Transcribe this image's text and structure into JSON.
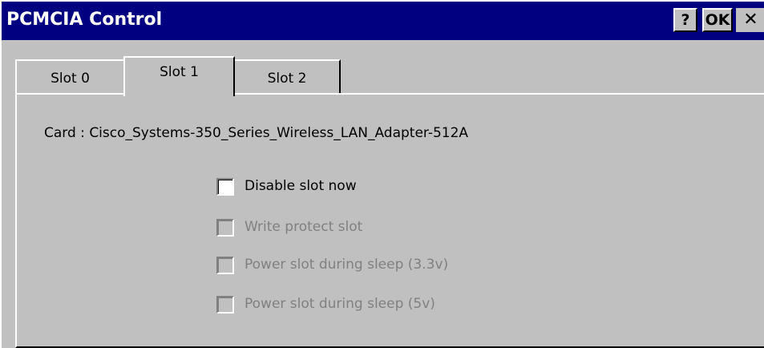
{
  "window": {
    "title": "PCMCIA Control",
    "help_label": "?",
    "ok_label": "OK",
    "close_label": "✕"
  },
  "tabs": [
    {
      "label": "Slot 0",
      "selected": false
    },
    {
      "label": "Slot 1",
      "selected": true
    },
    {
      "label": "Slot 2",
      "selected": false
    }
  ],
  "panel": {
    "card_prefix": "Card : ",
    "card_name": "Cisco_Systems-350_Series_Wireless_LAN_Adapter-512A",
    "options": [
      {
        "label": "Disable slot now",
        "checked": false,
        "enabled": true
      },
      {
        "label": "Write protect slot",
        "checked": false,
        "enabled": false
      },
      {
        "label": "Power slot during sleep (3.3v)",
        "checked": false,
        "enabled": false
      },
      {
        "label": "Power slot during sleep (5v)",
        "checked": false,
        "enabled": false
      }
    ]
  },
  "colors": {
    "titlebar": "#000080",
    "face": "#c0c0c0",
    "disabled_text": "#808080"
  }
}
